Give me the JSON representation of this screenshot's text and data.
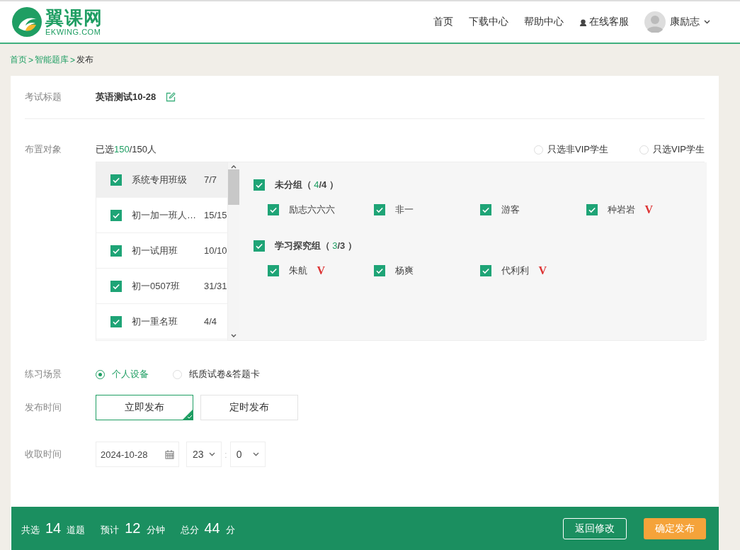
{
  "header": {
    "logo_text": "翼课网",
    "logo_subtext": "EKWING.COM",
    "nav": [
      {
        "label": "首页",
        "kind": "link"
      },
      {
        "label": "下载中心",
        "kind": "link"
      },
      {
        "label": "帮助中心",
        "kind": "link"
      },
      {
        "label": "在线客服",
        "kind": "service"
      }
    ],
    "user": {
      "name": "康励志"
    }
  },
  "breadcrumb": [
    {
      "label": "首页",
      "kind": "link"
    },
    {
      "label": ">",
      "kind": "sep"
    },
    {
      "label": "智能题库",
      "kind": "link"
    },
    {
      "label": ">",
      "kind": "sep"
    },
    {
      "label": "发布",
      "kind": "current"
    }
  ],
  "form": {
    "title_label": "考试标题",
    "title": "英语测试10-28",
    "target_label": "布置对象",
    "selected_prefix": "已选",
    "selected_count": "150",
    "selected_total": "/150人",
    "vip_filters": [
      {
        "label": "只选非VIP学生",
        "selected": false
      },
      {
        "label": "只选VIP学生",
        "selected": false
      }
    ],
    "classes": [
      {
        "name": "系统专用班级",
        "count": "7/7",
        "checked": true,
        "selected": true
      },
      {
        "name": "初一加一班人…",
        "count": "15/15",
        "checked": true,
        "selected": false
      },
      {
        "name": "初一试用班",
        "count": "10/10",
        "checked": true,
        "selected": false
      },
      {
        "name": "初一0507班",
        "count": "31/31",
        "checked": true,
        "selected": false
      },
      {
        "name": "初一重名班",
        "count": "4/4",
        "checked": true,
        "selected": false
      }
    ],
    "groups": [
      {
        "name": "未分组（ ",
        "picked": "4",
        "total": "/4 ）",
        "checked": true,
        "students": [
          {
            "name": "励志六六六",
            "checked": true
          },
          {
            "name": "非一",
            "checked": true
          },
          {
            "name": "游客",
            "checked": true
          },
          {
            "name": "种岩岩",
            "checked": true,
            "badge": "V"
          }
        ]
      },
      {
        "name": "学习探究组（ ",
        "picked": "3",
        "total": "/3 ）",
        "checked": true,
        "students": [
          {
            "name": "朱航",
            "checked": true,
            "badge": "V"
          },
          {
            "name": "杨爽",
            "checked": true
          },
          {
            "name": "代利利",
            "checked": true,
            "badge": "V"
          }
        ]
      }
    ],
    "scene_label": "练习场景",
    "scenes": [
      {
        "label": "个人设备",
        "selected": true
      },
      {
        "label": "纸质试卷&答题卡",
        "selected": false
      }
    ],
    "time_label": "发布时间",
    "publish_modes": [
      {
        "label": "立即发布",
        "selected": true
      },
      {
        "label": "定时发布",
        "selected": false
      }
    ],
    "collect_label": "收取时间",
    "collect_date": "2024-10-28",
    "collect_hour": "23",
    "collect_sep": ":",
    "collect_minute": "0"
  },
  "footer": {
    "count_prefix": "共选",
    "count": "14",
    "count_unit": "道题",
    "time_prefix": "预计",
    "time": "12",
    "time_unit": "分钟",
    "score_prefix": "总分",
    "score": "44",
    "score_unit": "分",
    "back_button": "返回修改",
    "confirm_button": "确定发布"
  }
}
